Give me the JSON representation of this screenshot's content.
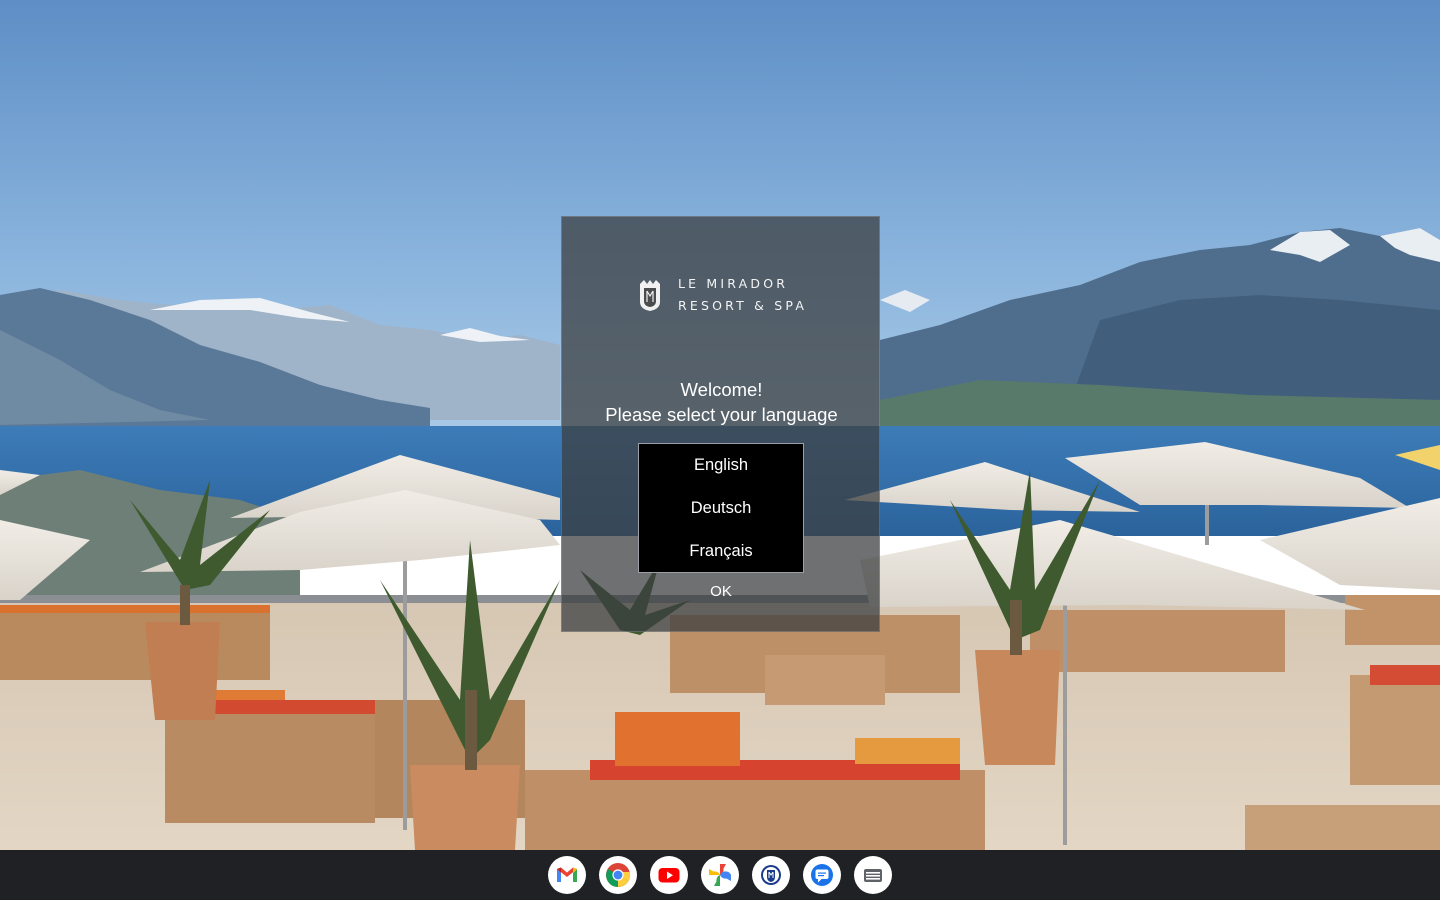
{
  "dialog": {
    "brand_line_1": "LE MIRADOR",
    "brand_line_2": "RESORT & SPA",
    "welcome": "Welcome!",
    "prompt": "Please select your language",
    "languages": [
      "English",
      "Deutsch",
      "Français"
    ],
    "ok_label": "OK"
  },
  "shelf": {
    "apps": [
      {
        "name": "gmail-icon"
      },
      {
        "name": "chrome-icon"
      },
      {
        "name": "youtube-icon"
      },
      {
        "name": "photos-icon"
      },
      {
        "name": "kiosk-app-icon"
      },
      {
        "name": "messages-icon"
      },
      {
        "name": "app-drawer-icon"
      }
    ]
  },
  "colors": {
    "dialog_bg": "#3c3e40",
    "shelf_bg": "#1f2125",
    "sky_top": "#5f8fc7",
    "lake": "#3a78b4"
  }
}
